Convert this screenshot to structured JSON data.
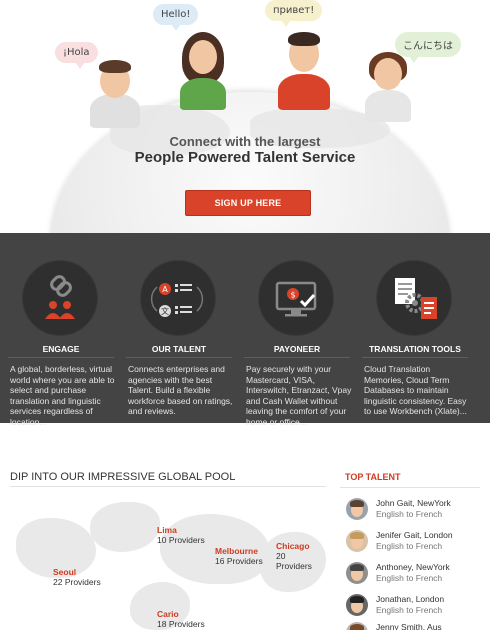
{
  "hero": {
    "bubbles": [
      "¡Hola",
      "Hello!",
      "привет!",
      "こんにちは"
    ],
    "subtitle": "Connect with the largest",
    "title": "People Powered Talent Service",
    "signup_label": "SIGN UP HERE"
  },
  "features": [
    {
      "title": "ENGAGE",
      "icon": "link-people-icon",
      "text": "A global, borderless, virtual world where you are able to select and purchase translation and linguistic services regardless of location..."
    },
    {
      "title": "OUR TALENT",
      "icon": "talent-exchange-icon",
      "text": "Connects enterprises and agencies with the best Talent. Build a flexible workforce based on ratings, and reviews."
    },
    {
      "title": "PAYONEER",
      "icon": "monitor-payment-icon",
      "text": "Pay securely with your Mastercard, VISA, Interswitch, Etranzact, Vpay and Cash Wallet without leaving the comfort of your home or office..."
    },
    {
      "title": "TRANSLATION TOOLS",
      "icon": "document-gear-icon",
      "text": "Cloud Translation Memories, Cloud Term Databases to maintain linguistic consistency. Easy to use Workbench (Xlate)..."
    }
  ],
  "pool": {
    "title": "DIP INTO OUR IMPRESSIVE GLOBAL POOL",
    "cities": [
      {
        "name": "Lima",
        "providers": "10 Providers"
      },
      {
        "name": "Melbourne",
        "providers": "16 Providers"
      },
      {
        "name": "Chicago",
        "providers": "20 Providers"
      },
      {
        "name": "Seoul",
        "providers": "22 Providers"
      },
      {
        "name": "Cario",
        "providers": "18 Providers"
      }
    ]
  },
  "top_talent": {
    "title": "TOP TALENT",
    "items": [
      {
        "name": "John Gait, NewYork",
        "lang": "English to French"
      },
      {
        "name": "Jenifer Gait, London",
        "lang": "English to French"
      },
      {
        "name": "Anthoney, NewYork",
        "lang": "English to French"
      },
      {
        "name": "Jonathan, London",
        "lang": "English to French"
      },
      {
        "name": "Jenny Smith, Aus",
        "lang": ""
      }
    ]
  },
  "colors": {
    "accent": "#d9432a",
    "dark_band": "#444444",
    "circle": "#2f2f2f"
  }
}
